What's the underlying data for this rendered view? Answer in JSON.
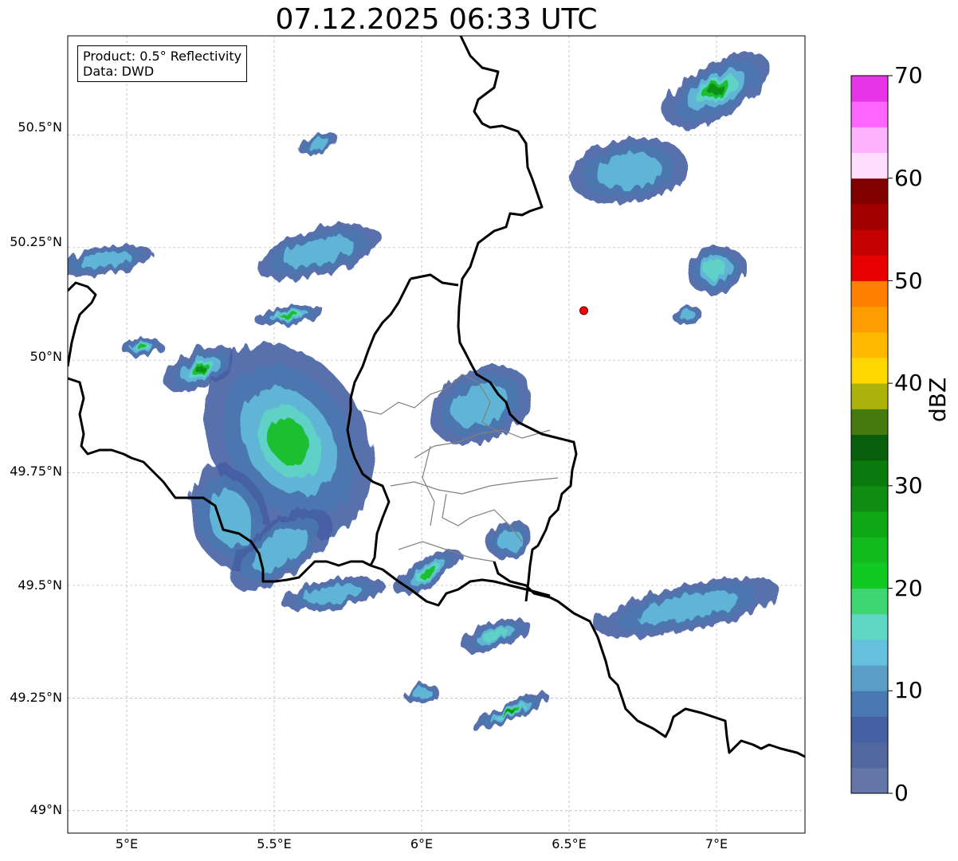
{
  "title": "07.12.2025 06:33 UTC",
  "info": {
    "product": "Product: 0.5° Reflectivity",
    "source": "Data: DWD"
  },
  "map": {
    "lon_range": [
      4.8,
      7.3
    ],
    "lat_range": [
      48.95,
      50.72
    ],
    "gridlines": true,
    "lat_ticks": [
      {
        "value": 50.5,
        "label": "50.5°N"
      },
      {
        "value": 50.25,
        "label": "50.25°N"
      },
      {
        "value": 50.0,
        "label": "50°N"
      },
      {
        "value": 49.75,
        "label": "49.75°N"
      },
      {
        "value": 49.5,
        "label": "49.5°N"
      },
      {
        "value": 49.25,
        "label": "49.25°N"
      },
      {
        "value": 49.0,
        "label": "49°N"
      }
    ],
    "lon_ticks": [
      {
        "value": 5.0,
        "label": "5°E"
      },
      {
        "value": 5.5,
        "label": "5.5°E"
      },
      {
        "value": 6.0,
        "label": "6°E"
      },
      {
        "value": 6.5,
        "label": "6.5°E"
      },
      {
        "value": 7.0,
        "label": "7°E"
      }
    ],
    "radar_site": {
      "lon": 6.55,
      "lat": 50.11,
      "color": "#ff0000"
    }
  },
  "colorbar": {
    "label": "dBZ",
    "min": 0,
    "max": 70,
    "step": 2.5,
    "ticks": [
      "0",
      "10",
      "20",
      "30",
      "40",
      "50",
      "60",
      "70"
    ],
    "colors": [
      "#6577a8",
      "#5266a0",
      "#4561a3",
      "#4a78b0",
      "#5a9ec8",
      "#64c0dc",
      "#60d6c4",
      "#3dd672",
      "#12c823",
      "#14bb1f",
      "#10a715",
      "#0f8c12",
      "#0b7a0e",
      "#075e0b",
      "#447a0e",
      "#acb40b",
      "#ffd700",
      "#ffb900",
      "#ff9c00",
      "#ff7f00",
      "#e60000",
      "#c40000",
      "#a30000",
      "#800000",
      "#ffdeff",
      "#ffb3ff",
      "#ff66ff",
      "#e833e8"
    ]
  },
  "echoes": [
    {
      "lon": 5.55,
      "lat": 49.82,
      "rlon": 0.26,
      "rlat": 0.23,
      "rot": -30,
      "level": 0.55
    },
    {
      "lon": 5.35,
      "lat": 49.65,
      "rlon": 0.13,
      "rlat": 0.12,
      "rot": -20,
      "level": 0.25
    },
    {
      "lon": 5.52,
      "lat": 49.58,
      "rlon": 0.2,
      "rlat": 0.06,
      "rot": -35,
      "level": 0.2
    },
    {
      "lon": 5.25,
      "lat": 49.98,
      "rlon": 0.13,
      "rlat": 0.04,
      "rot": -25,
      "level": 0.6
    },
    {
      "lon": 4.93,
      "lat": 50.22,
      "rlon": 0.16,
      "rlat": 0.03,
      "rot": -10,
      "level": 0.3
    },
    {
      "lon": 5.65,
      "lat": 50.24,
      "rlon": 0.22,
      "rlat": 0.05,
      "rot": -15,
      "level": 0.25
    },
    {
      "lon": 5.55,
      "lat": 50.1,
      "rlon": 0.12,
      "rlat": 0.02,
      "rot": -8,
      "level": 0.55
    },
    {
      "lon": 5.05,
      "lat": 50.03,
      "rlon": 0.07,
      "rlat": 0.02,
      "rot": -5,
      "level": 0.5
    },
    {
      "lon": 6.7,
      "lat": 50.42,
      "rlon": 0.2,
      "rlat": 0.07,
      "rot": -10,
      "level": 0.2
    },
    {
      "lon": 7.0,
      "lat": 50.6,
      "rlon": 0.2,
      "rlat": 0.06,
      "rot": -30,
      "level": 0.65
    },
    {
      "lon": 7.0,
      "lat": 50.2,
      "rlon": 0.1,
      "rlat": 0.05,
      "rot": -20,
      "level": 0.4
    },
    {
      "lon": 6.9,
      "lat": 49.45,
      "rlon": 0.32,
      "rlat": 0.05,
      "rot": -12,
      "level": 0.3
    },
    {
      "lon": 6.3,
      "lat": 49.22,
      "rlon": 0.14,
      "rlat": 0.02,
      "rot": -25,
      "level": 0.6
    },
    {
      "lon": 6.25,
      "lat": 49.39,
      "rlon": 0.12,
      "rlat": 0.03,
      "rot": -20,
      "level": 0.35
    },
    {
      "lon": 6.02,
      "lat": 49.53,
      "rlon": 0.13,
      "rlat": 0.03,
      "rot": -30,
      "level": 0.45
    },
    {
      "lon": 5.7,
      "lat": 49.48,
      "rlon": 0.18,
      "rlat": 0.03,
      "rot": -10,
      "level": 0.12
    },
    {
      "lon": 6.2,
      "lat": 49.9,
      "rlon": 0.18,
      "rlat": 0.08,
      "rot": -25,
      "level": 0.12
    },
    {
      "lon": 6.3,
      "lat": 49.6,
      "rlon": 0.08,
      "rlat": 0.04,
      "rot": -20,
      "level": 0.1
    },
    {
      "lon": 6.0,
      "lat": 49.26,
      "rlon": 0.06,
      "rlat": 0.02,
      "rot": -10,
      "level": 0.1
    },
    {
      "lon": 5.65,
      "lat": 50.48,
      "rlon": 0.07,
      "rlat": 0.02,
      "rot": -20,
      "level": 0.1
    },
    {
      "lon": 6.9,
      "lat": 50.1,
      "rlon": 0.05,
      "rlat": 0.02,
      "rot": -10,
      "level": 0.1
    }
  ]
}
